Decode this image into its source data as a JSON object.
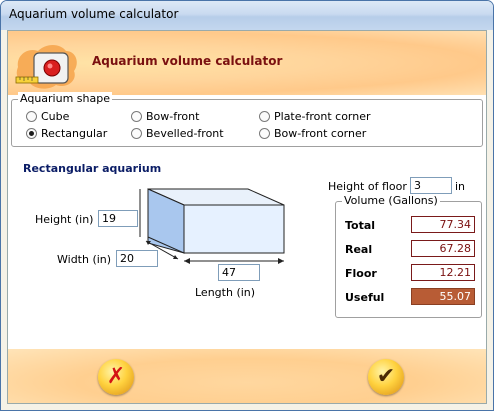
{
  "window": {
    "title": "Aquarium volume calculator"
  },
  "banner": {
    "title": "Aquarium volume calculator"
  },
  "shape_group": {
    "legend": "Aquarium shape",
    "options": [
      {
        "label": "Cube",
        "selected": false
      },
      {
        "label": "Rectangular",
        "selected": true
      },
      {
        "label": "Bow-front",
        "selected": false
      },
      {
        "label": "Bevelled-front",
        "selected": false
      },
      {
        "label": "Plate-front corner",
        "selected": false
      },
      {
        "label": "Bow-front corner",
        "selected": false
      }
    ]
  },
  "section_title": "Rectangular aquarium",
  "dimensions": {
    "height_label": "Height (in)",
    "height_value": "19",
    "width_label": "Width (in)",
    "width_value": "20",
    "length_label": "Length (in)",
    "length_value": "47"
  },
  "floor": {
    "label": "Height of floor",
    "value": "3",
    "unit": "in"
  },
  "volume": {
    "legend": "Volume (Gallons)",
    "total_label": "Total",
    "total_value": "77.34",
    "real_label": "Real",
    "real_value": "67.28",
    "floor_label": "Floor",
    "floor_value": "12.21",
    "useful_label": "Useful",
    "useful_value": "55.07"
  },
  "buttons": {
    "cancel_icon": "cancel-x-icon",
    "ok_icon": "checkmark-icon"
  },
  "colors": {
    "accent_dark_red": "#7a1010",
    "useful_bg": "#b85c35",
    "section_blue": "#0b1d66"
  }
}
